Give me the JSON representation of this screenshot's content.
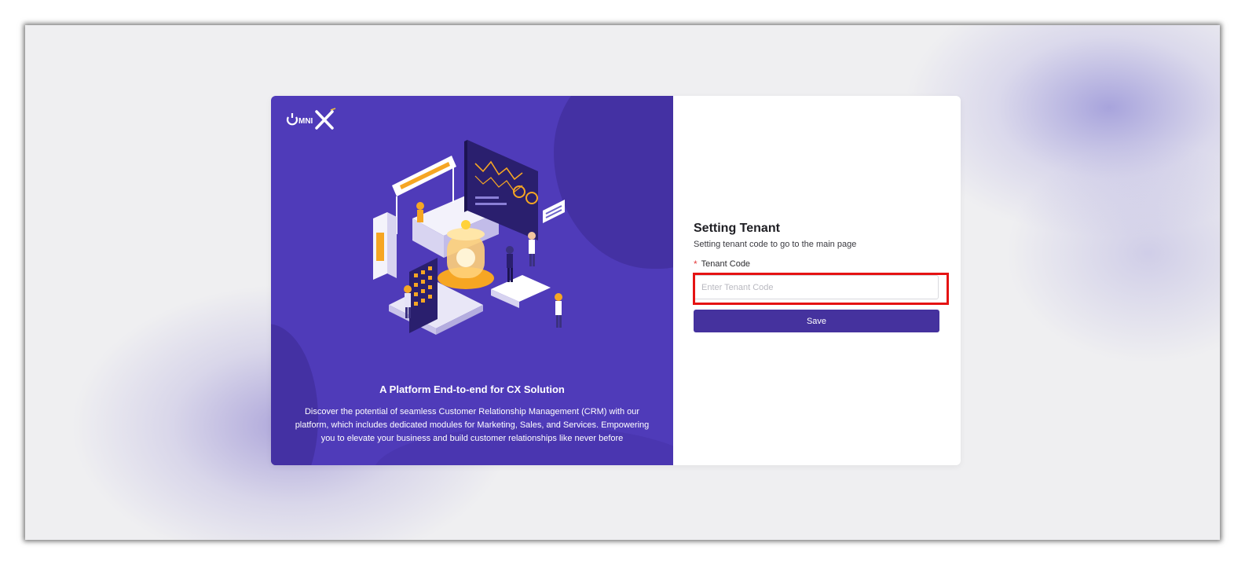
{
  "brand": {
    "logo_text": "OMNIX",
    "accent": "#4f3bb9",
    "button_color": "#45329e",
    "highlight_color": "#e51313"
  },
  "left_panel": {
    "illustration": "crm-dashboard-isometric-illustration",
    "title": "A Platform End-to-end for CX Solution",
    "description": "Discover the potential of seamless Customer Relationship Management (CRM) with our platform, which includes dedicated modules for Marketing, Sales, and Services. Empowering you to elevate your business and build customer relationships like never before"
  },
  "form": {
    "title": "Setting Tenant",
    "subtitle": "Setting tenant code to go to the main page",
    "required_mark": "*",
    "tenant_label": "Tenant Code",
    "tenant_value": "",
    "tenant_placeholder": "Enter Tenant Code",
    "save_label": "Save"
  }
}
